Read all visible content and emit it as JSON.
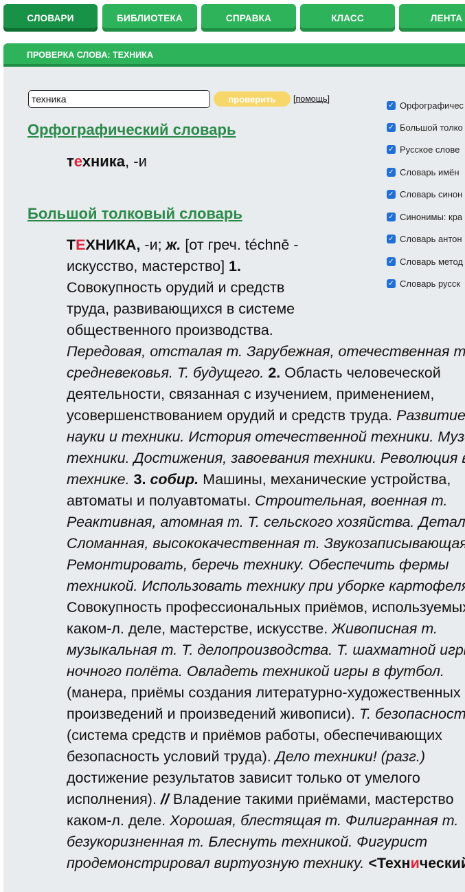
{
  "nav": {
    "tabs": [
      {
        "label": "СЛОВАРИ",
        "active": true
      },
      {
        "label": "БИБЛИОТЕКА",
        "active": false
      },
      {
        "label": "СПРАВКА",
        "active": false
      },
      {
        "label": "КЛАСС",
        "active": false
      },
      {
        "label": "ЛЕНТА",
        "active": false
      }
    ]
  },
  "page": {
    "subtitle": "ПРОВЕРКА СЛОВА: ТЕХНИКА"
  },
  "search": {
    "value": "техника",
    "button_label": "проверить",
    "help_label": "[помощь]"
  },
  "dictionaries": [
    {
      "label": "Орфографичес",
      "checked": true
    },
    {
      "label": "Большой толко",
      "checked": true
    },
    {
      "label": "Русское слове",
      "checked": true
    },
    {
      "label": "Словарь имён",
      "checked": true
    },
    {
      "label": "Словарь синон",
      "checked": true
    },
    {
      "label": "Синонимы: кра",
      "checked": true
    },
    {
      "label": "Словарь антон",
      "checked": true
    },
    {
      "label": "Словарь метод",
      "checked": true
    },
    {
      "label": "Словарь русск",
      "checked": true
    }
  ],
  "orth": {
    "title": "Орфографический словарь",
    "word_pre": "т",
    "word_accent": "е",
    "word_post": "хника",
    "suffix": ", -и"
  },
  "big": {
    "title": "Большой толковый словарь",
    "headword_pre": "Т",
    "headword_accent": "Е",
    "headword_post": "ХНИКА,",
    "lines": [
      [
        {
          "t": "Т",
          "s": "b"
        },
        {
          "t": "Е",
          "s": "ba"
        },
        {
          "t": "ХНИКА,",
          "s": "b"
        },
        {
          "t": " -и; ",
          "s": ""
        },
        {
          "t": "ж.",
          "s": "bi"
        },
        {
          "t": " [от греч. téchnē -",
          "s": ""
        }
      ],
      [
        {
          "t": "искусство, мастерство] ",
          "s": ""
        },
        {
          "t": "1.",
          "s": "b"
        }
      ],
      [
        {
          "t": "Совокупность орудий и средств",
          "s": ""
        }
      ],
      [
        {
          "t": "труда, развивающихся в системе",
          "s": ""
        }
      ],
      [
        {
          "t": "общественного производства.",
          "s": ""
        }
      ],
      [
        {
          "t": "Передовая, отсталая т. Зарубежная, отечественная т.",
          "s": "i"
        }
      ],
      [
        {
          "t": "средневековья. Т. будущего. ",
          "s": "i"
        },
        {
          "t": "2.",
          "s": "b"
        },
        {
          "t": " Область человеческой",
          "s": ""
        }
      ],
      [
        {
          "t": "деятельности, связанная с изучением, применением,",
          "s": ""
        }
      ],
      [
        {
          "t": "усовершенствованием орудий и средств труда. ",
          "s": ""
        },
        {
          "t": "Развитие",
          "s": "i"
        }
      ],
      [
        {
          "t": "науки и техники. История отечественной техники. Музей",
          "s": "i"
        }
      ],
      [
        {
          "t": "техники. Достижения, завоевания техники. Революция в",
          "s": "i"
        }
      ],
      [
        {
          "t": "технике. ",
          "s": "i"
        },
        {
          "t": "3. ",
          "s": "b"
        },
        {
          "t": "собир.",
          "s": "bi"
        },
        {
          "t": " Машины, механические устройства,",
          "s": ""
        }
      ],
      [
        {
          "t": "автоматы и полуавтоматы. ",
          "s": ""
        },
        {
          "t": "Строительная, военная т.",
          "s": "i"
        }
      ],
      [
        {
          "t": "Реактивная, атомная т. Т. сельского хозяйства. Детали",
          "s": "i"
        }
      ],
      [
        {
          "t": "Сломанная, высококачественная т. Звукозаписывающая",
          "s": "i"
        }
      ],
      [
        {
          "t": "Ремонтировать, беречь технику. Обеспечить фермы",
          "s": "i"
        }
      ],
      [
        {
          "t": "техникой. Использовать технику при уборке картофеля.",
          "s": "i"
        }
      ],
      [
        {
          "t": "Совокупность профессиональных приёмов, используемых в",
          "s": ""
        }
      ],
      [
        {
          "t": "каком-л. деле, мастерстве, искусстве. ",
          "s": ""
        },
        {
          "t": "Живописная т.",
          "s": "i"
        }
      ],
      [
        {
          "t": "музыкальная т. Т. делопроизводства. Т. шахматной игры.",
          "s": "i"
        }
      ],
      [
        {
          "t": "ночного полёта. Овладеть техникой игры в футбол.",
          "s": "i"
        }
      ],
      [
        {
          "t": "(манера, приёмы создания литературно-художественных",
          "s": ""
        }
      ],
      [
        {
          "t": "произведений и произведений живописи). ",
          "s": ""
        },
        {
          "t": "Т. безопасности",
          "s": "i"
        }
      ],
      [
        {
          "t": "(система средств и приёмов работы, обеспечивающих",
          "s": ""
        }
      ],
      [
        {
          "t": "безопасность условий труда). ",
          "s": ""
        },
        {
          "t": "Дело техники! (разг.)",
          "s": "i"
        }
      ],
      [
        {
          "t": "достижение результатов зависит только от умелого",
          "s": ""
        }
      ],
      [
        {
          "t": "исполнения). ",
          "s": ""
        },
        {
          "t": "//",
          "s": "bi"
        },
        {
          "t": " Владение такими приёмами, мастерство",
          "s": ""
        }
      ],
      [
        {
          "t": "каком-л. деле. ",
          "s": ""
        },
        {
          "t": "Хорошая, блестящая т. Филигранная т.",
          "s": "i"
        }
      ],
      [
        {
          "t": "безукоризненная т. Блеснуть техникой. Фигурист",
          "s": "i"
        }
      ],
      [
        {
          "t": "продемонстрировал виртуозную технику. ",
          "s": "i"
        },
        {
          "t": "<Техн",
          "s": "b"
        },
        {
          "t": "и",
          "s": "ba"
        },
        {
          "t": "ческий",
          "s": "b"
        }
      ]
    ]
  },
  "colors": {
    "green": "#2db35a",
    "green_dark": "#179247",
    "title_green": "#2a8a4a",
    "accent_red": "#e0223a",
    "yellow": "#f7d76a",
    "content_bg": "#e9ecee"
  }
}
